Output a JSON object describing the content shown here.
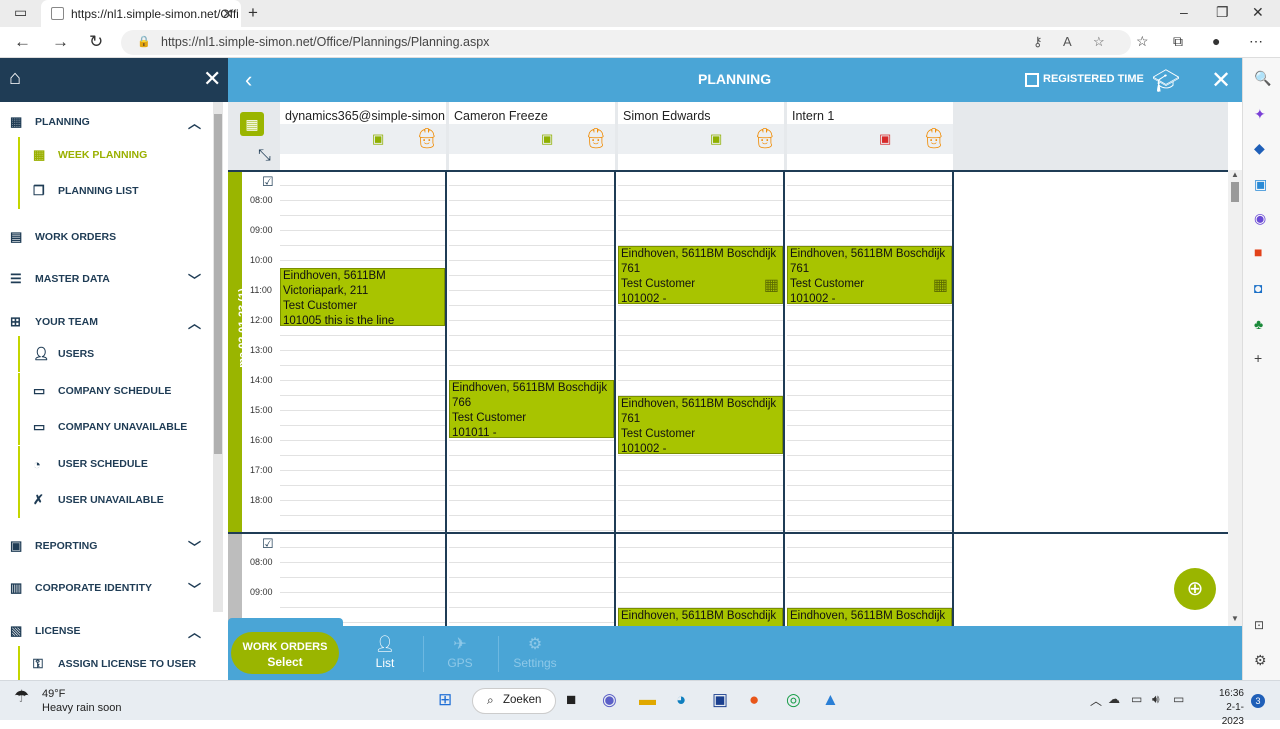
{
  "browser": {
    "tab_title": "https://nl1.simple-simon.net/Offi",
    "url": "https://nl1.simple-simon.net/Office/Plannings/Planning.aspx"
  },
  "sidebar": {
    "planning": "PLANNING",
    "week_planning": "WEEK PLANNING",
    "planning_list": "PLANNING LIST",
    "work_orders": "WORK ORDERS",
    "master_data": "MASTER DATA",
    "your_team": "YOUR TEAM",
    "users": "USERS",
    "company_schedule": "COMPANY SCHEDULE",
    "company_unavailable": "COMPANY UNAVAILABLE",
    "user_schedule": "USER SCHEDULE",
    "user_unavailable": "USER UNAVAILABLE",
    "reporting": "REPORTING",
    "corporate_identity": "CORPORATE IDENTITY",
    "license": "LICENSE",
    "assign_license": "ASSIGN LICENSE TO USER"
  },
  "topbar": {
    "title": "PLANNING",
    "registered_time": "REGISTERED TIME"
  },
  "columns": [
    {
      "name": "dynamics365@simple-simon",
      "cert_color": "#8fb000"
    },
    {
      "name": "Cameron Freeze",
      "cert_color": "#8fb000"
    },
    {
      "name": "Simon Edwards",
      "cert_color": "#8fb000"
    },
    {
      "name": "Intern 1",
      "cert_color": "#d62a2a"
    }
  ],
  "day1": {
    "label": "ma 02-01-23 (1)",
    "times": [
      "08:00",
      "09:00",
      "10:00",
      "11:00",
      "12:00",
      "13:00",
      "14:00",
      "15:00",
      "16:00",
      "17:00",
      "18:00"
    ]
  },
  "day2": {
    "times": [
      "08:00",
      "09:00"
    ]
  },
  "appointments": {
    "a1": {
      "l1": "Eindhoven, 5611BM",
      "l2": "Victoriapark, 211",
      "l3": "Test Customer",
      "l4": "101005 this is the line"
    },
    "a2": {
      "l1": "Eindhoven, 5611BM Boschdijk",
      "l2": "766",
      "l3": "Test Customer",
      "l4": "101011 -"
    },
    "a3": {
      "l1": "Eindhoven, 5611BM Boschdijk",
      "l2": "761",
      "l3": "Test Customer",
      "l4": "101002 -"
    },
    "a4": {
      "l1": "Eindhoven, 5611BM Boschdijk",
      "l2": "761",
      "l3": "Test Customer",
      "l4": "101002 -"
    },
    "a5": {
      "l1": "Eindhoven, 5611BM Boschdijk",
      "l2": "761",
      "l3": "Test Customer",
      "l4": "101002 -"
    },
    "a6": {
      "l1": "Eindhoven, 5611BM Boschdijk"
    },
    "a7": {
      "l1": "Eindhoven, 5611BM Boschdijk"
    }
  },
  "bottombar": {
    "work_orders": "WORK ORDERS",
    "select": "Select",
    "list": "List",
    "gps": "GPS",
    "settings": "Settings"
  },
  "taskbar": {
    "temp": "49°F",
    "weather": "Heavy rain soon",
    "search": "Zoeken",
    "time": "16:36",
    "date": "2-1-2023",
    "notifications": "3"
  },
  "colors": {
    "accent_blue": "#4aa5d6",
    "navy": "#1f3c55",
    "appointment_green": "#a8c400"
  }
}
